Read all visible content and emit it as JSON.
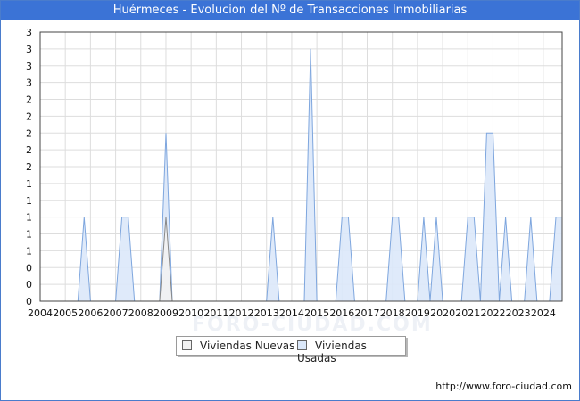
{
  "title": "Huérmeces - Evolucion del Nº de Transacciones Inmobiliarias",
  "watermark": "FORO-CIUDAD.COM",
  "credit": "http://www.foro-ciudad.com",
  "colors": {
    "title_bg": "#3b73d6",
    "nuevas_fill": "#f2f2f2",
    "nuevas_stroke": "#888888",
    "usadas_fill": "#dbe8fa",
    "usadas_stroke": "#7ea6de",
    "grid": "#dddddd"
  },
  "legend": {
    "items": [
      {
        "name": "Viviendas Nuevas"
      },
      {
        "name": "Viviendas Usadas"
      }
    ]
  },
  "chart_data": {
    "type": "area",
    "x_unit": "quarter",
    "xlim": [
      "2004-Q1",
      "2024-Q4"
    ],
    "xticks": [
      "2004",
      "2005",
      "2006",
      "2007",
      "2008",
      "2009",
      "2010",
      "2011",
      "2012",
      "2013",
      "2014",
      "2015",
      "2016",
      "2017",
      "2018",
      "2019",
      "2020",
      "2021",
      "2022",
      "2023",
      "2024"
    ],
    "ylim": [
      0,
      3.2
    ],
    "yticks": [
      0,
      0.2,
      0.4,
      0.6,
      0.8,
      1.0,
      1.2,
      1.4,
      1.6,
      1.8,
      2.0,
      2.2,
      2.4,
      2.6,
      2.8,
      3.0,
      3.2
    ],
    "ytick_labels": [
      "0",
      "0",
      "0",
      "1",
      "1",
      "1",
      "1",
      "1",
      "2",
      "2",
      "2",
      "2",
      "2",
      "3",
      "3",
      "3",
      "3"
    ],
    "grid": true,
    "legend_position": "bottom",
    "series": [
      {
        "name": "Viviendas Nuevas",
        "points": [
          {
            "x": "2009-Q1",
            "y": 1
          }
        ]
      },
      {
        "name": "Viviendas Usadas",
        "points": [
          {
            "x": "2005-Q4",
            "y": 1
          },
          {
            "x": "2007-Q2",
            "y": 1
          },
          {
            "x": "2007-Q3",
            "y": 1
          },
          {
            "x": "2009-Q1",
            "y": 2
          },
          {
            "x": "2013-Q2",
            "y": 1
          },
          {
            "x": "2014-Q4",
            "y": 3
          },
          {
            "x": "2016-Q1",
            "y": 1
          },
          {
            "x": "2016-Q2",
            "y": 1
          },
          {
            "x": "2018-Q1",
            "y": 1
          },
          {
            "x": "2018-Q2",
            "y": 1
          },
          {
            "x": "2019-Q2",
            "y": 1
          },
          {
            "x": "2019-Q4",
            "y": 1
          },
          {
            "x": "2021-Q1",
            "y": 1
          },
          {
            "x": "2021-Q2",
            "y": 1
          },
          {
            "x": "2021-Q4",
            "y": 2
          },
          {
            "x": "2022-Q1",
            "y": 2
          },
          {
            "x": "2022-Q3",
            "y": 1
          },
          {
            "x": "2023-Q3",
            "y": 1
          },
          {
            "x": "2024-Q3",
            "y": 1
          },
          {
            "x": "2024-Q4",
            "y": 1
          }
        ]
      }
    ]
  }
}
